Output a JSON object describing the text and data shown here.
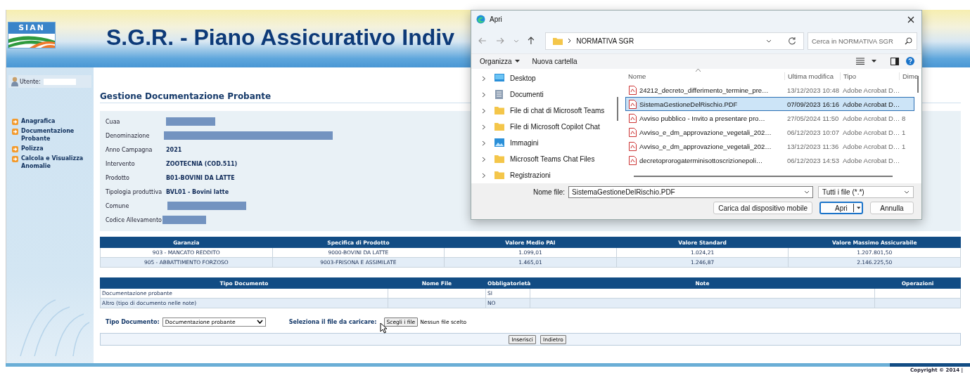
{
  "header": {
    "logo_text": "SIAN",
    "title": "S.G.R. - Piano Assicurativo Indiv"
  },
  "sidebar": {
    "user_label": "Utente:",
    "menu": [
      {
        "label": "Anagrafica"
      },
      {
        "label": "Documentazione Probante"
      },
      {
        "label": "Polizza"
      },
      {
        "label": "Calcola e Visualizza Anomalie"
      }
    ]
  },
  "page_title": "Gestione Documentazione Probante",
  "details": [
    {
      "label": "Cuaa",
      "kind": "redacted"
    },
    {
      "label": "Denominazione",
      "kind": "redacted"
    },
    {
      "label": "Anno Campagna",
      "kind": "text",
      "value": "2021"
    },
    {
      "label": "Intervento",
      "kind": "text",
      "value": "ZOOTECNIA (COD.511)"
    },
    {
      "label": "Prodotto",
      "kind": "text",
      "value": "B01-BOVINI DA LATTE"
    },
    {
      "label": "Tipologia produttiva",
      "kind": "text",
      "value": "BVL01 - Bovini latte"
    },
    {
      "label": "Comune",
      "kind": "redacted"
    },
    {
      "label": "Codice Allevamento",
      "kind": "redacted"
    }
  ],
  "guarantees_table": {
    "columns": [
      "Garanzia",
      "Specifica di Prodotto",
      "Valore Medio PAI",
      "Valore Standard",
      "Valore Massimo Assicurabile"
    ],
    "rows": [
      [
        "903 - MANCATO REDDITO",
        "9000-BOVINI DA LATTE",
        "1.099,01",
        "1.024,21",
        "1.207.801,50"
      ],
      [
        "905 - ABBATTIMENTO FORZOSO",
        "9003-FRISONA E ASSIMILATE",
        "1.465,01",
        "1.246,87",
        "2.146.225,50"
      ]
    ]
  },
  "documents_table": {
    "columns": [
      "Tipo Documento",
      "Nome File",
      "Obbligatorietà",
      "Note",
      "Operazioni"
    ],
    "rows": [
      [
        "Documentazione probante",
        "",
        "SI",
        "",
        ""
      ],
      [
        "Altro (tipo di documento nelle note)",
        "",
        "NO",
        "",
        ""
      ]
    ]
  },
  "upload_form": {
    "type_label": "Tipo Documento:",
    "type_value": "Documentazione probante",
    "file_label": "Seleziona il file da caricare:",
    "file_button": "Scegli i file",
    "file_status": "Nessun file scelto"
  },
  "actions": [
    "Inserisci",
    "Indietro"
  ],
  "footer": {
    "copyright": "Copyright © 2014 |"
  },
  "dialog": {
    "title": "Apri",
    "path": "NORMATIVA SGR",
    "search": {
      "placeholder": "Cerca in NORMATIVA SGR"
    },
    "toolbar": [
      {
        "label": "Organizza",
        "kind": "menu"
      },
      {
        "label": "Nuova cartella",
        "kind": "plain"
      }
    ],
    "tree": [
      {
        "label": "Desktop",
        "kind": "desktop",
        "expanded": false
      },
      {
        "label": "Documenti",
        "kind": "document",
        "expanded": false
      },
      {
        "label": "File di chat di Microsoft Teams",
        "kind": "folder",
        "expanded": false
      },
      {
        "label": "File di Microsoft Copilot Chat",
        "kind": "folder",
        "expanded": false
      },
      {
        "label": "Immagini",
        "kind": "image",
        "expanded": false
      },
      {
        "label": "Microsoft Teams Chat Files",
        "kind": "folder",
        "expanded": false
      },
      {
        "label": "Registrazioni",
        "kind": "folder",
        "expanded": false
      }
    ],
    "columns": [
      "Nome",
      "Ultima modifica",
      "Tipo",
      "Dime"
    ],
    "files": [
      {
        "name": "24212_decreto_differimento_termine_pre…",
        "modified": "13/12/2023 10:48",
        "type": "Adobe Acrobat D…",
        "selected": false
      },
      {
        "name": "SistemaGestioneDelRischio.PDF",
        "modified": "07/09/2023 16:16",
        "type": "Adobe Acrobat D…",
        "selected": true
      },
      {
        "name": "Avviso pubblico - Invito a presentare pro…",
        "modified": "27/05/2024 11:50",
        "type": "Adobe Acrobat D…",
        "size": "8",
        "selected": false
      },
      {
        "name": "Avviso_e_dm_approvazione_vegetali_202…",
        "modified": "06/12/2023 10:07",
        "type": "Adobe Acrobat D…",
        "size": "1",
        "selected": false
      },
      {
        "name": "Avviso_e_dm_approvazione_vegetali_202…",
        "modified": "13/12/2023 11:36",
        "type": "Adobe Acrobat D…",
        "size": "1",
        "selected": false
      },
      {
        "name": "decretoprorogaterminisottoscrizionepoli…",
        "modified": "06/12/2023 14:53",
        "type": "Adobe Acrobat D…",
        "selected": false
      }
    ],
    "filename_label": "Nome file:",
    "filename": "SistemaGestioneDelRischio.PDF",
    "filetype": "Tutti i file (*.*)",
    "buttons": [
      {
        "label": "Carica dal dispositivo mobile",
        "kind": "plain"
      },
      {
        "label": "Apri",
        "kind": "split"
      },
      {
        "label": "Annulla",
        "kind": "plain"
      }
    ]
  }
}
